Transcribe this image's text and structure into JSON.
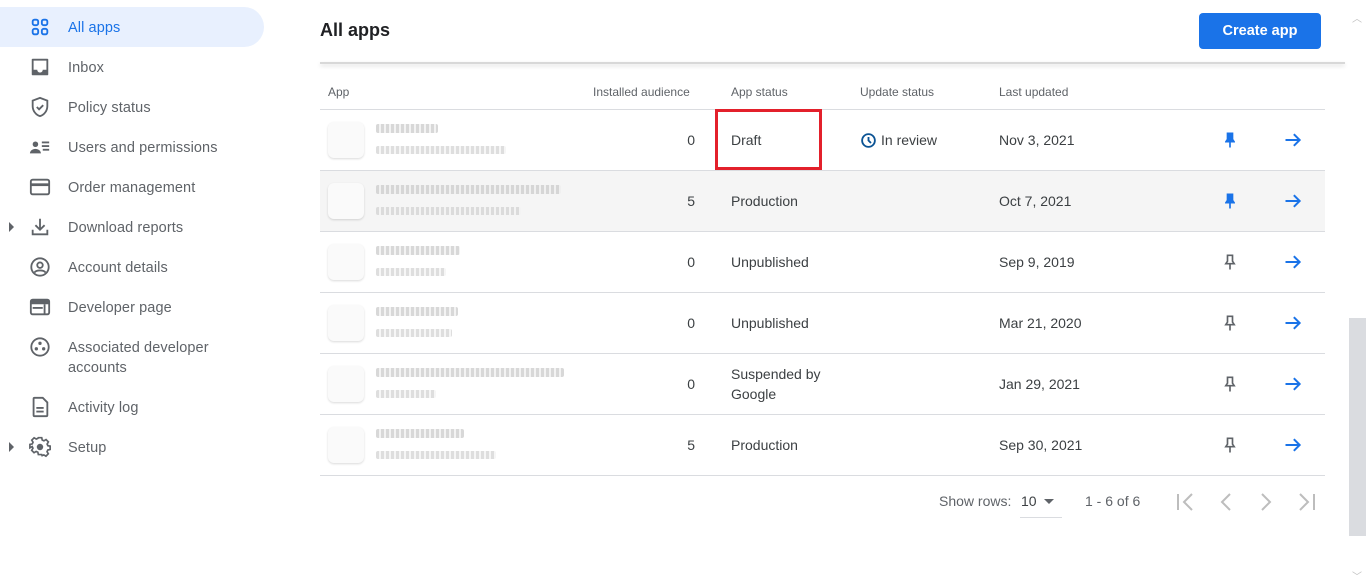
{
  "sidebar": {
    "items": [
      {
        "label": "All apps",
        "icon": "apps-grid-icon",
        "active": true,
        "expandable": false
      },
      {
        "label": "Inbox",
        "icon": "inbox-icon",
        "active": false,
        "expandable": false
      },
      {
        "label": "Policy status",
        "icon": "shield-check-icon",
        "active": false,
        "expandable": false
      },
      {
        "label": "Users and permissions",
        "icon": "users-list-icon",
        "active": false,
        "expandable": false
      },
      {
        "label": "Order management",
        "icon": "credit-card-icon",
        "active": false,
        "expandable": false
      },
      {
        "label": "Download reports",
        "icon": "download-icon",
        "active": false,
        "expandable": true
      },
      {
        "label": "Account details",
        "icon": "account-circle-icon",
        "active": false,
        "expandable": false
      },
      {
        "label": "Developer page",
        "icon": "web-page-icon",
        "active": false,
        "expandable": false
      },
      {
        "label": "Associated developer accounts",
        "icon": "linked-accounts-icon",
        "active": false,
        "expandable": false
      },
      {
        "label": "Activity log",
        "icon": "document-icon",
        "active": false,
        "expandable": false
      },
      {
        "label": "Setup",
        "icon": "gear-icon",
        "active": false,
        "expandable": true
      }
    ]
  },
  "header": {
    "title": "All apps",
    "create_button": "Create app"
  },
  "table": {
    "columns": [
      "App",
      "Installed audience",
      "App status",
      "Update status",
      "Last updated"
    ],
    "rows": [
      {
        "app_name": "",
        "installed_audience": "0",
        "app_status": "Draft",
        "update_status": "In review",
        "last_updated": "Nov 3, 2021",
        "pinned": true
      },
      {
        "app_name": "",
        "installed_audience": "5",
        "app_status": "Production",
        "update_status": "",
        "last_updated": "Oct 7, 2021",
        "pinned": true
      },
      {
        "app_name": "",
        "installed_audience": "0",
        "app_status": "Unpublished",
        "update_status": "",
        "last_updated": "Sep 9, 2019",
        "pinned": false
      },
      {
        "app_name": "",
        "installed_audience": "0",
        "app_status": "Unpublished",
        "update_status": "",
        "last_updated": "Mar 21, 2020",
        "pinned": false
      },
      {
        "app_name": "",
        "installed_audience": "0",
        "app_status": "Suspended by Google",
        "update_status": "",
        "last_updated": "Jan 29, 2021",
        "pinned": false
      },
      {
        "app_name": "",
        "installed_audience": "5",
        "app_status": "Production",
        "update_status": "",
        "last_updated": "Sep 30, 2021",
        "pinned": false
      }
    ]
  },
  "pagination": {
    "show_rows_label": "Show rows:",
    "rows_per_page": "10",
    "range": "1 - 6 of 6"
  },
  "colors": {
    "accent": "#1a73e8",
    "highlight_box": "#e3202b",
    "in_review_icon": "#0b5394"
  }
}
